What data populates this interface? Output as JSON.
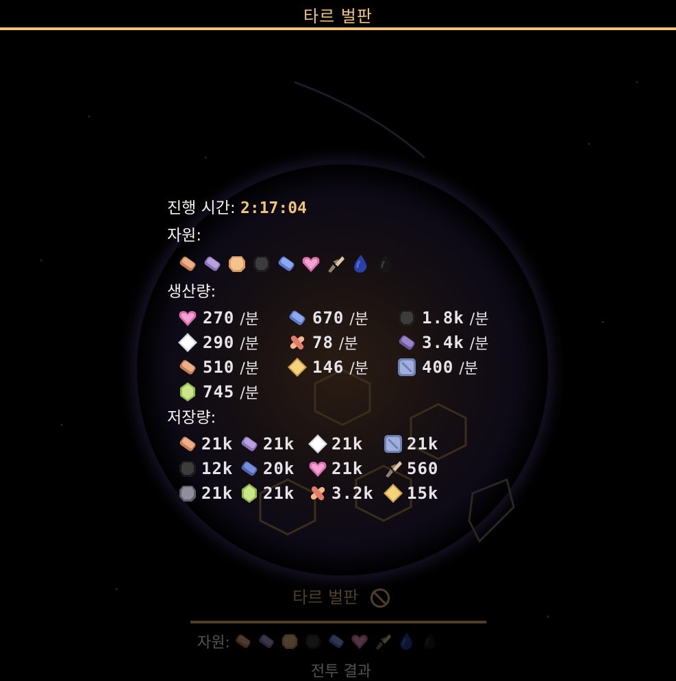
{
  "window": {
    "title": "타르 벌판"
  },
  "colors": {
    "accent": "#f1c37a",
    "text": "#f4f1ec",
    "background": "#000000"
  },
  "icons": {
    "copper": {
      "shape": "bar",
      "c1": "#eab08a",
      "c2": "#c97c55"
    },
    "titanium": {
      "shape": "bar",
      "c1": "#b7a2dd",
      "c2": "#8c73b8"
    },
    "sand": {
      "shape": "chunk",
      "c1": "#f3c28f",
      "c2": "#d99a65"
    },
    "coal": {
      "shape": "chunk",
      "c1": "#3c3c3c",
      "c2": "#1c1c1c"
    },
    "plastanium": {
      "shape": "bar",
      "c1": "#8ba8f0",
      "c2": "#5f78c9"
    },
    "spore": {
      "shape": "heart",
      "c1": "#f5a1d2",
      "c2": "#d670ae"
    },
    "scrap": {
      "shape": "shards",
      "c1": "#dcc6a6",
      "c2": "#8e7d6c"
    },
    "oil": {
      "shape": "drop",
      "c1": "#4f6de0",
      "c2": "#2a40a8"
    },
    "tar": {
      "shape": "drop",
      "c1": "#3a3a3a",
      "c2": "#161616"
    },
    "metaglass": {
      "shape": "diamond",
      "c1": "#ffffff",
      "c2": "#cfd4e0"
    },
    "pyratite": {
      "shape": "cross",
      "c1": "#f6b48a",
      "c2": "#e07c6a"
    },
    "surge": {
      "shape": "diamond",
      "c1": "#f3d37c",
      "c2": "#d2a24a"
    },
    "silicon": {
      "shape": "block",
      "c1": "#9fb0dd",
      "c2": "#6f80b3"
    },
    "phase": {
      "shape": "gem",
      "c1": "#cbe689",
      "c2": "#94b94c"
    },
    "lead": {
      "shape": "chunk",
      "c1": "#8e8f9c",
      "c2": "#5e5f6a"
    },
    "graphite": {
      "shape": "bar",
      "c1": "#7a8fdc",
      "c2": "#4f62b0"
    },
    "thorium": {
      "shape": "bar",
      "c1": "#9c84c8",
      "c2": "#6d559b"
    }
  },
  "summary": {
    "progress_label": "진행 시간:",
    "progress_time": "2:17:04",
    "resources_label": "자원:",
    "resource_icons": [
      "copper",
      "titanium",
      "sand",
      "coal",
      "plastanium",
      "spore",
      "scrap",
      "oil",
      "tar"
    ],
    "production_label": "생산량:",
    "production": [
      [
        {
          "icon": "spore",
          "value": "270",
          "unit": "/분"
        },
        {
          "icon": "plastanium",
          "value": "670",
          "unit": "/분"
        },
        {
          "icon": "coal",
          "value": "1.8k",
          "unit": "/분"
        }
      ],
      [
        {
          "icon": "metaglass",
          "value": "290",
          "unit": "/분"
        },
        {
          "icon": "pyratite",
          "value": "78",
          "unit": "/분"
        },
        {
          "icon": "thorium",
          "value": "3.4k",
          "unit": "/분"
        }
      ],
      [
        {
          "icon": "copper",
          "value": "510",
          "unit": "/분"
        },
        {
          "icon": "surge",
          "value": "146",
          "unit": "/분"
        },
        {
          "icon": "silicon",
          "value": "400",
          "unit": "/분"
        }
      ],
      [
        {
          "icon": "phase",
          "value": "745",
          "unit": "/분"
        }
      ]
    ],
    "storage_label": "저장량:",
    "storage": [
      [
        {
          "icon": "copper",
          "value": "21k"
        },
        {
          "icon": "titanium",
          "value": "21k"
        },
        {
          "icon": "metaglass",
          "value": "21k"
        },
        {
          "icon": "silicon",
          "value": "21k"
        }
      ],
      [
        {
          "icon": "coal",
          "value": "12k"
        },
        {
          "icon": "graphite",
          "value": "20k"
        },
        {
          "icon": "spore",
          "value": "21k"
        },
        {
          "icon": "scrap",
          "value": "560"
        }
      ],
      [
        {
          "icon": "lead",
          "value": "21k"
        },
        {
          "icon": "phase",
          "value": "21k"
        },
        {
          "icon": "pyratite",
          "value": "3.2k"
        },
        {
          "icon": "surge",
          "value": "15k"
        }
      ]
    ]
  },
  "sector_panel": {
    "title": "타르 벌판",
    "resources_label": "자원:",
    "resource_icons": [
      "copper",
      "titanium",
      "sand",
      "coal",
      "plastanium",
      "spore",
      "scrap",
      "oil",
      "tar"
    ],
    "result_label": "전투 결과"
  }
}
